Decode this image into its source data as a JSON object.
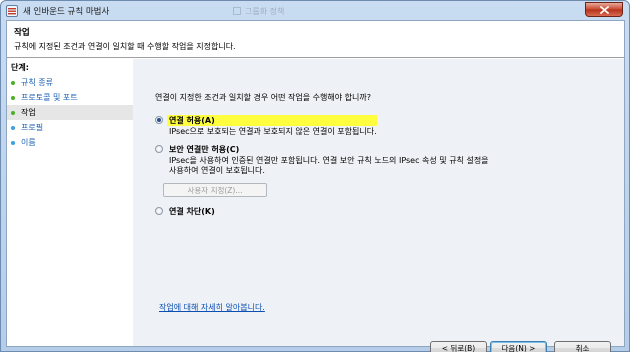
{
  "window": {
    "title": "새 인바운드 규칙 마법사",
    "background_title": "그룹화 정책"
  },
  "header": {
    "title": "작업",
    "description": "규칙에 지정된 조건과 연결이 일치할 때 수행할 작업을 지정합니다."
  },
  "sidebar": {
    "steps_label": "단계:",
    "steps": [
      {
        "label": "규칙 종류",
        "state": "done"
      },
      {
        "label": "프로토콜 및 포트",
        "state": "done"
      },
      {
        "label": "작업",
        "state": "active"
      },
      {
        "label": "프로필",
        "state": "pending"
      },
      {
        "label": "이름",
        "state": "pending"
      }
    ]
  },
  "content": {
    "question": "연결이 지정한 조건과 일치할 경우 어떤 작업을 수행해야 합니까?",
    "options": [
      {
        "label": "연결 허용(A)",
        "description": [
          "IPsec으로 보호되는 연결과 보호되지 않은 연결이 포함됩니다."
        ],
        "selected": true
      },
      {
        "label": "보안 연결만 허용(C)",
        "description": [
          "IPsec을 사용하여 인증된 연결만 포함됩니다. 연결 보안 규칙 노드의 IPsec 속성 및 규칙 설정을",
          "사용하여 연결이 보호됩니다."
        ],
        "selected": false
      },
      {
        "label": "연결 차단(K)",
        "description": [],
        "selected": false
      }
    ],
    "customize_label": "사용자 지정(Z)...",
    "learn_more_link": "작업에 대해 자세히 알아봅니다."
  },
  "footer": {
    "back_label": "< 뒤로(B)",
    "next_label": "다음(N) >",
    "cancel_label": "취소"
  },
  "colors": {
    "accent_link": "#1a5fb4",
    "done_dot": "#4caf2a",
    "pending_dot": "#3aa0e0",
    "active_dot": "#4caf2a",
    "highlight": "#ffff40"
  },
  "icons": {
    "app": "firewall-wizard-icon",
    "close": "close-icon"
  }
}
